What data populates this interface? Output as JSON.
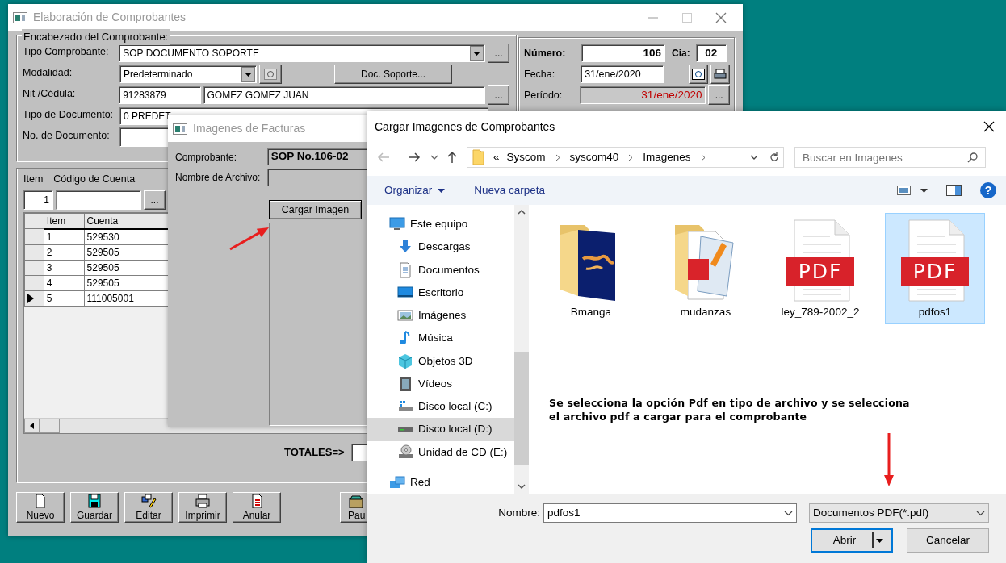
{
  "main_window": {
    "title": "Elaboración de Comprobantes",
    "header": {
      "title": "Encabezado del Comprobante:",
      "tipo_comprobante": {
        "label": "Tipo Comprobante:",
        "value": "SOP  DOCUMENTO SOPORTE",
        "button": "..."
      },
      "modalidad": {
        "label": "Modalidad:",
        "value": "Predeterminado",
        "button": "Doc. Soporte..."
      },
      "nit": {
        "label": "Nit /Cédula:",
        "id_value": "91283879",
        "name_value": "GOMEZ GOMEZ JUAN",
        "button": "..."
      },
      "tipo_documento": {
        "label": "Tipo de Documento:",
        "value": "0  PREDET"
      },
      "numero_documento": {
        "label": "No. de Documento:"
      }
    },
    "summary": {
      "numero": {
        "label": "Número:",
        "value": "106"
      },
      "cia": {
        "label": "Cia:",
        "value": "02"
      },
      "fecha": {
        "label": "Fecha:",
        "value": "31/ene/2020"
      },
      "periodo": {
        "label": "Período:",
        "value": "31/ene/2020",
        "button": "..."
      }
    },
    "entry": {
      "item_label": "Item",
      "account_label": "Código de Cuenta",
      "item_value": "1",
      "button": "..."
    },
    "table": {
      "columns": [
        "Item",
        "Cuenta"
      ],
      "rows": [
        {
          "cells": [
            "1",
            "529530"
          ],
          "selected": false
        },
        {
          "cells": [
            "2",
            "529505"
          ],
          "selected": false
        },
        {
          "cells": [
            "3",
            "529505"
          ],
          "selected": false
        },
        {
          "cells": [
            "4",
            "529505"
          ],
          "selected": false
        },
        {
          "cells": [
            "5",
            "111005001"
          ],
          "selected": true
        }
      ]
    },
    "totals_label": "TOTALES=>",
    "toolbar": [
      {
        "label": "Nuevo",
        "kind": "new"
      },
      {
        "label": "Guardar",
        "kind": "save"
      },
      {
        "label": "Editar",
        "kind": "edit"
      },
      {
        "label": "Imprimir",
        "kind": "print"
      },
      {
        "label": "Anular",
        "kind": "void"
      },
      {
        "label": "Pau",
        "kind": "folder"
      }
    ]
  },
  "images_window": {
    "title": "Imagenes de Facturas",
    "comprobante": {
      "label": "Comprobante:",
      "value": "SOP No.106-02"
    },
    "archivo": {
      "label": "Nombre de Archivo:"
    },
    "button": "Cargar Imagen"
  },
  "file_dialog": {
    "title": "Cargar Imagenes de Comprobantes",
    "path_overflow": "«",
    "path": [
      "Syscom",
      "syscom40",
      "Imagenes"
    ],
    "search": {
      "placeholder": "Buscar en Imagenes"
    },
    "toolbar": {
      "organize": "Organizar",
      "new_folder": "Nueva carpeta",
      "help": "?"
    },
    "sidebar": [
      {
        "label": "Este equipo",
        "kind": "pc",
        "selected": false,
        "children": [
          {
            "label": "Descargas",
            "kind": "download",
            "selected": false
          },
          {
            "label": "Documentos",
            "kind": "documents",
            "selected": false
          },
          {
            "label": "Escritorio",
            "kind": "desktop",
            "selected": false
          },
          {
            "label": "Imágenes",
            "kind": "pictures",
            "selected": false
          },
          {
            "label": "Música",
            "kind": "music",
            "selected": false
          },
          {
            "label": "Objetos 3D",
            "kind": "objects3d",
            "selected": false
          },
          {
            "label": "Vídeos",
            "kind": "videos",
            "selected": false
          },
          {
            "label": "Disco local (C:)",
            "kind": "system-drive",
            "selected": false
          },
          {
            "label": "Disco local (D:)",
            "kind": "drive",
            "selected": true
          },
          {
            "label": "Unidad de CD (E:)",
            "kind": "cd",
            "selected": false
          }
        ]
      },
      {
        "label": "Red",
        "kind": "network",
        "selected": false
      }
    ],
    "files": [
      {
        "name": "Bmanga",
        "kind": "picture-folder",
        "selected": false
      },
      {
        "name": "mudanzas",
        "kind": "document-folder",
        "selected": false
      },
      {
        "name": "ley_789-2002_2",
        "kind": "pdf",
        "badge": "PDF",
        "selected": false
      },
      {
        "name": "pdfos1",
        "kind": "pdf",
        "badge": "PDF",
        "selected": true
      }
    ],
    "filename": {
      "label": "Nombre:",
      "value": "pdfos1"
    },
    "filetype": {
      "value": "Documentos PDF(*.pdf)"
    },
    "buttons": [
      {
        "label": "Abrir",
        "kind": "split",
        "focused": true
      },
      {
        "label": "Cancelar",
        "kind": "plain",
        "focused": false
      }
    ]
  },
  "annotation": {
    "lines": [
      "Se selecciona la opción Pdf en tipo de archivo y se selecciona",
      "el archivo pdf a cargar para el comprobante"
    ]
  }
}
